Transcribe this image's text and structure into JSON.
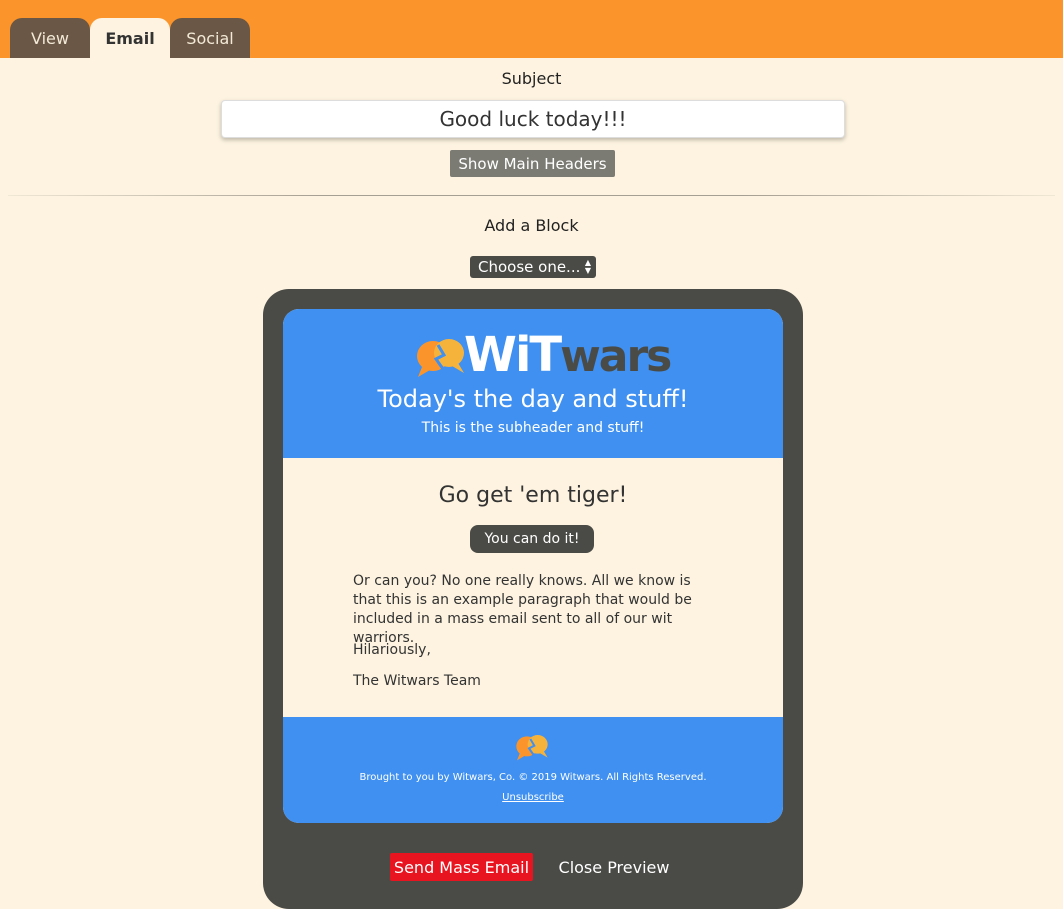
{
  "tabs": [
    {
      "label": "View"
    },
    {
      "label": "Email"
    },
    {
      "label": "Social"
    }
  ],
  "subject": {
    "label": "Subject",
    "value": "Good luck today!!!"
  },
  "show_headers_label": "Show Main Headers",
  "add_block": {
    "label": "Add a Block",
    "select_value": "Choose one..."
  },
  "email": {
    "logo": {
      "wi": "WiT",
      "wars": "wars"
    },
    "headline": "Today's the day and stuff!",
    "subheadline": "This is the subheader and stuff!",
    "body_title": "Go get 'em tiger!",
    "cta_label": "You can do it!",
    "paragraphs": [
      "Or can you? No one really knows. All we know is that this is an example paragraph that would be included in a mass email sent to all of our wit warriors.",
      "Hilariously,",
      "The Witwars Team"
    ],
    "footer_text": "Brought to you by Witwars, Co. © 2019 Witwars. All Rights Reserved.",
    "unsubscribe": "Unsubscribe"
  },
  "actions": {
    "send_label": "Send Mass Email",
    "close_label": "Close Preview"
  },
  "colors": {
    "topbar": "#fb952b",
    "background": "#fdf3e0",
    "email_blue": "#3f90f0",
    "dark": "#4a4b46",
    "send_red": "#e8141f"
  }
}
